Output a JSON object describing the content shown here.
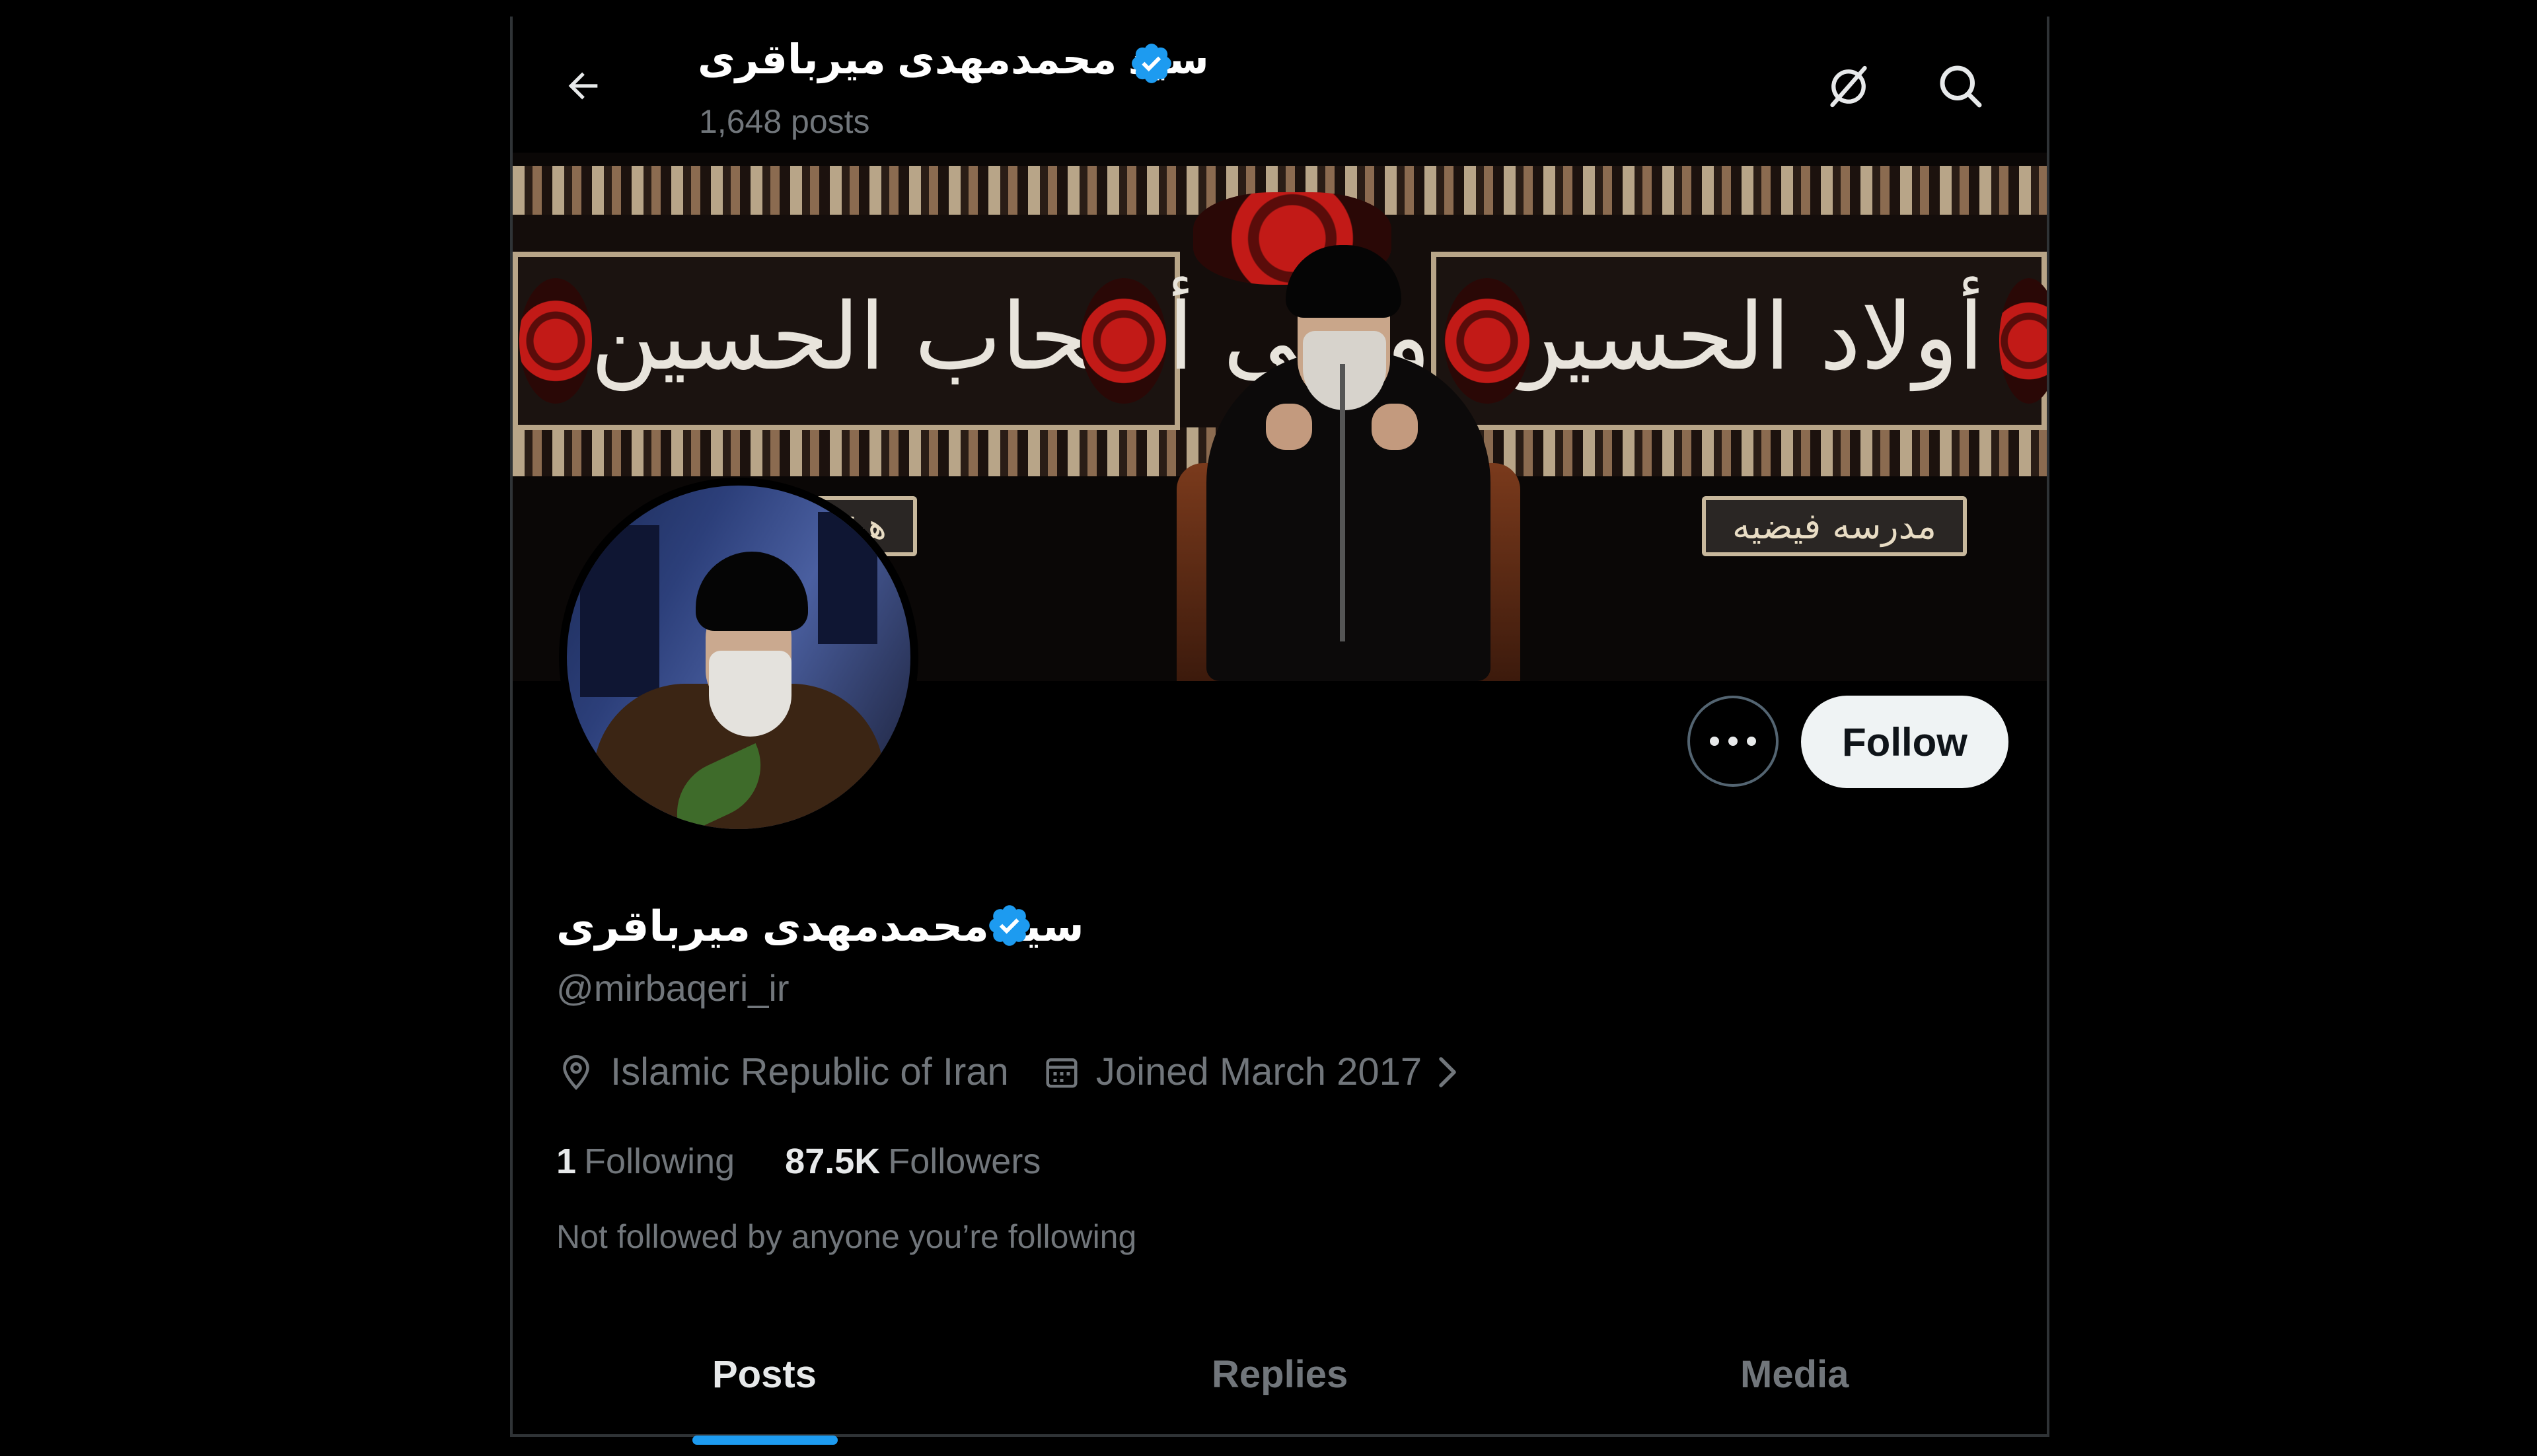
{
  "header": {
    "title": "سید محمدمهدی میرباقری",
    "posts_count": "1,648 posts"
  },
  "banner": {
    "calligraphy_left": "وعلی أصحاب الحسين",
    "calligraphy_right": "وعلی أولاد الحسين",
    "plaque_left": "هيئة",
    "plaque_right": "مدرسه فيضيه"
  },
  "actions": {
    "follow_label": "Follow"
  },
  "profile": {
    "display_name": "سید محمدمهدی میرباقری",
    "handle": "@mirbaqeri_ir",
    "location": "Islamic Republic of Iran",
    "joined": "Joined March 2017",
    "following_count": "1",
    "following_label": "Following",
    "followers_count": "87.5K",
    "followers_label": "Followers",
    "not_followed": "Not followed by anyone you’re following"
  },
  "tabs": [
    {
      "label": "Posts",
      "active": true
    },
    {
      "label": "Replies",
      "active": false
    },
    {
      "label": "Media",
      "active": false
    }
  ],
  "colors": {
    "verified_badge": "#1d9bf0",
    "tab_indicator": "#1d9bf0",
    "muted_text": "#71767b",
    "background": "#000000"
  },
  "icons": [
    "back-arrow-icon",
    "verified-badge-icon",
    "grok-icon",
    "search-icon",
    "more-icon",
    "location-pin-icon",
    "calendar-icon",
    "chevron-right-icon"
  ]
}
